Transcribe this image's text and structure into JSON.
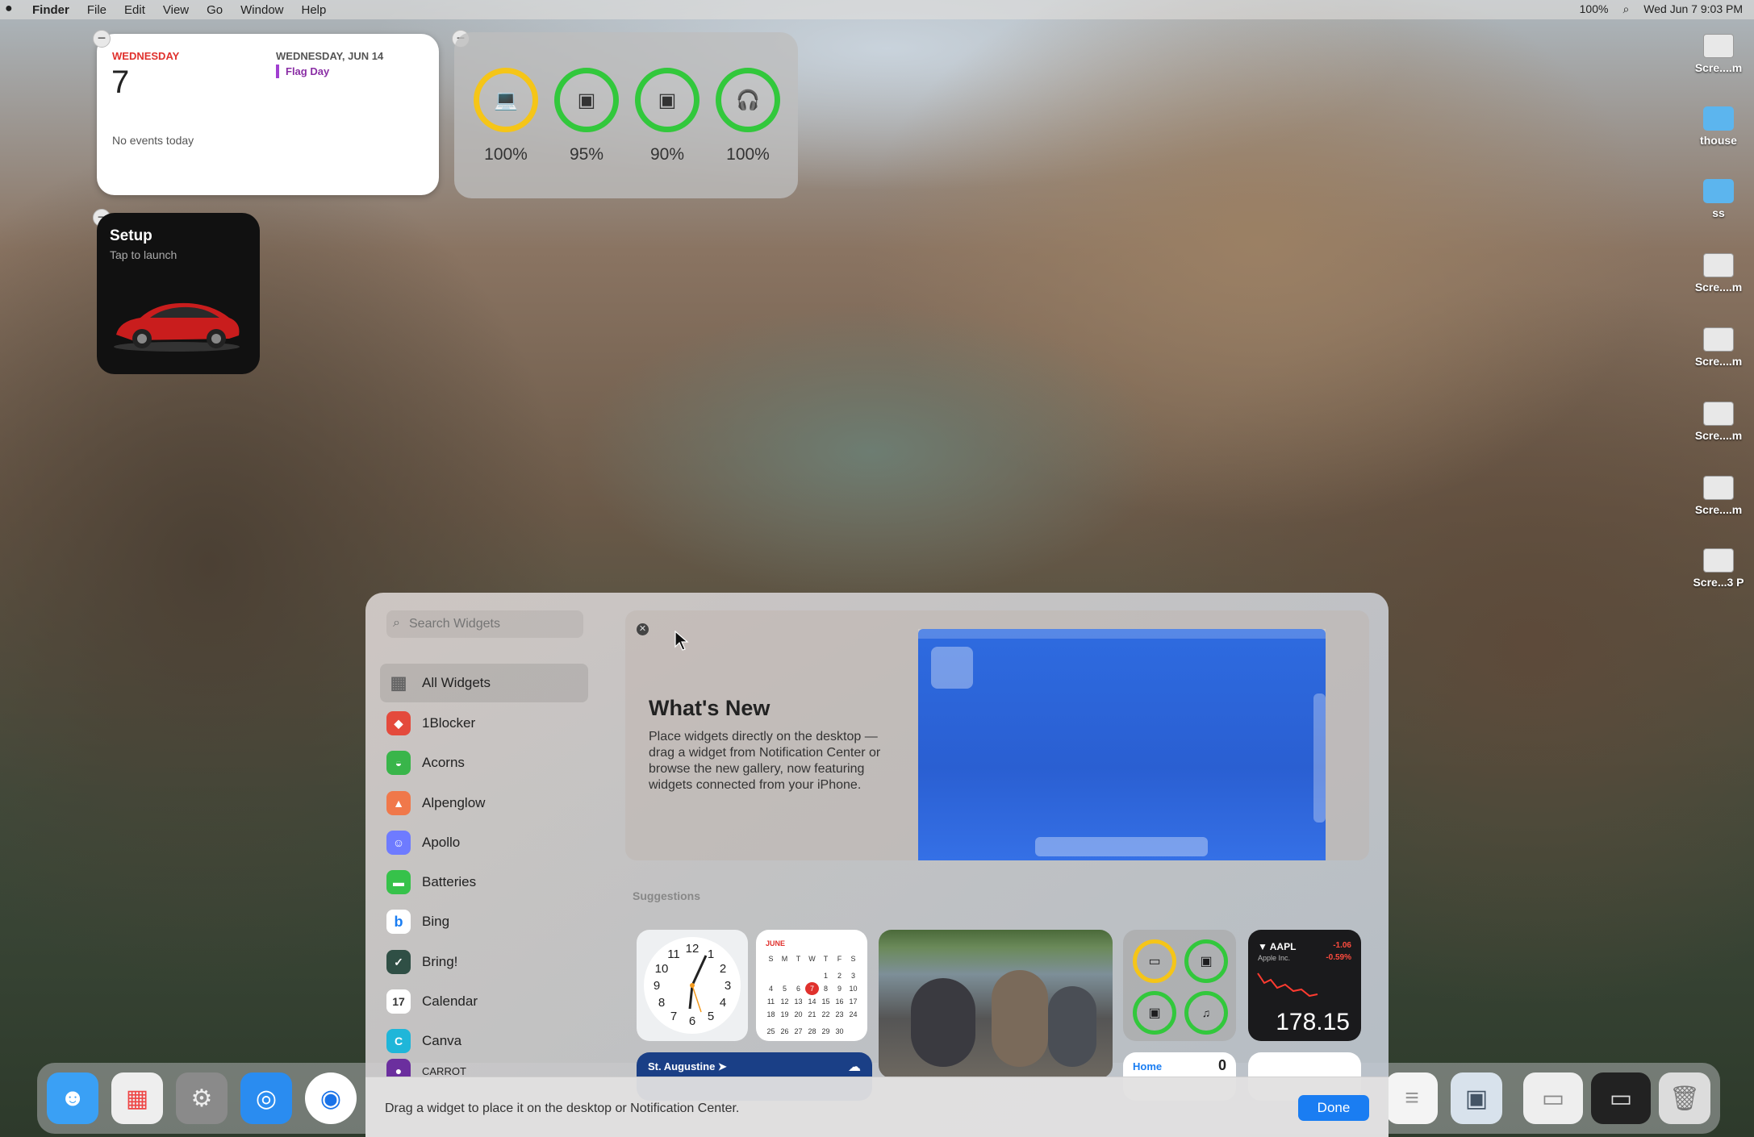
{
  "menubar": {
    "apple": "",
    "items": [
      "Finder",
      "File",
      "Edit",
      "View",
      "Go",
      "Window",
      "Help"
    ],
    "battery": "100%",
    "clock": "Wed Jun 7  9:03 PM"
  },
  "calendar_widget": {
    "weekday": "WEDNESDAY",
    "day": "7",
    "no_events": "No events today",
    "next_date": "WEDNESDAY, JUN 14",
    "next_event": "Flag Day"
  },
  "batteries_widget": {
    "devices": [
      {
        "icon": "laptop-icon",
        "glyph": "💻",
        "percent": "100%",
        "color": "#f5c518"
      },
      {
        "icon": "airpods-case-icon",
        "glyph": "▣",
        "percent": "95%",
        "color": "#32c83c"
      },
      {
        "icon": "airpods-case-icon",
        "glyph": "▣",
        "percent": "90%",
        "color": "#32c83c"
      },
      {
        "icon": "airpods-icon",
        "glyph": "🎧",
        "percent": "100%",
        "color": "#32c83c"
      }
    ]
  },
  "tesla_widget": {
    "title": "Setup",
    "subtitle": "Tap to launch"
  },
  "desktop_icons": [
    {
      "label": "Scre....m",
      "kind": "thumb"
    },
    {
      "label": "thouse",
      "kind": "folder"
    },
    {
      "label": "ss",
      "kind": "folder"
    },
    {
      "label": "Scre....m",
      "kind": "thumb"
    },
    {
      "label": "Scre....m",
      "kind": "thumb"
    },
    {
      "label": "Scre....m",
      "kind": "thumb"
    },
    {
      "label": "Scre....m",
      "kind": "thumb"
    },
    {
      "label": "Scre...3 P",
      "kind": "thumb"
    }
  ],
  "gallery": {
    "search_placeholder": "Search Widgets",
    "sidebar": [
      {
        "label": "All Widgets",
        "icon": "grid-icon",
        "color": "transparent",
        "glyph": "▦",
        "selected": true
      },
      {
        "label": "1Blocker",
        "icon": "1blocker-icon",
        "color": "#e44a3c",
        "glyph": "◆"
      },
      {
        "label": "Acorns",
        "icon": "acorns-icon",
        "color": "#39b54a",
        "glyph": "◒"
      },
      {
        "label": "Alpenglow",
        "icon": "alpenglow-icon",
        "color": "#f0784a",
        "glyph": "▲"
      },
      {
        "label": "Apollo",
        "icon": "apollo-icon",
        "color": "#6e7bff",
        "glyph": "☺"
      },
      {
        "label": "Batteries",
        "icon": "batteries-icon",
        "color": "#36c24a",
        "glyph": "▬"
      },
      {
        "label": "Bing",
        "icon": "bing-icon",
        "color": "#ffffff",
        "glyph": "b"
      },
      {
        "label": "Bring!",
        "icon": "bring-icon",
        "color": "#2f4f45",
        "glyph": "✓"
      },
      {
        "label": "Calendar",
        "icon": "calendar-icon",
        "color": "#ffffff",
        "glyph": "17"
      },
      {
        "label": "Canva",
        "icon": "canva-icon",
        "color": "#1fb6d9",
        "glyph": "C"
      },
      {
        "label": "CARROT",
        "icon": "carrot-icon",
        "color": "#6b2f9e",
        "glyph": "●"
      }
    ],
    "whats_new": {
      "title": "What's New",
      "body": "Place widgets directly on the desktop — drag a widget from Notification Center or browse the new gallery, now featuring widgets connected from your iPhone."
    },
    "suggestions_label": "Suggestions",
    "suggestion_tiles": {
      "clock_numbers": [
        "12",
        "1",
        "2",
        "3",
        "4",
        "5",
        "6",
        "7",
        "8",
        "9",
        "10",
        "11"
      ],
      "calendar_month": "JUNE",
      "calendar_weekdays": [
        "S",
        "M",
        "T",
        "W",
        "T",
        "F",
        "S"
      ],
      "calendar_rows": [
        [
          "",
          "",
          "",
          "",
          "1",
          "2",
          "3"
        ],
        [
          "4",
          "5",
          "6",
          "7",
          "8",
          "9",
          "10"
        ],
        [
          "11",
          "12",
          "13",
          "14",
          "15",
          "16",
          "17"
        ],
        [
          "18",
          "19",
          "20",
          "21",
          "22",
          "23",
          "24"
        ],
        [
          "25",
          "26",
          "27",
          "28",
          "29",
          "30",
          ""
        ]
      ],
      "stock": {
        "symbol": "AAPL",
        "name": "Apple Inc.",
        "change": "-1.06",
        "change_pct": "-0.59%",
        "price": "178.15"
      },
      "weather": {
        "city": "St. Augustine"
      },
      "home": {
        "label": "Home",
        "count": "0"
      }
    },
    "footer_hint": "Drag a widget to place it on the desktop or Notification Center.",
    "done_label": "Done"
  },
  "dock": {
    "apps": [
      {
        "name": "finder-icon",
        "glyph": "☻",
        "color": "#3aa0f5"
      },
      {
        "name": "launchpad-icon",
        "glyph": "▦",
        "color": "#eeeeee"
      },
      {
        "name": "system-settings-icon",
        "glyph": "⚙",
        "color": "#8a8a8a"
      },
      {
        "name": "safari-icon",
        "glyph": "◎",
        "color": "#2a8cf0"
      },
      {
        "name": "chrome-icon",
        "glyph": "◉",
        "color": "#ffffff"
      }
    ]
  }
}
